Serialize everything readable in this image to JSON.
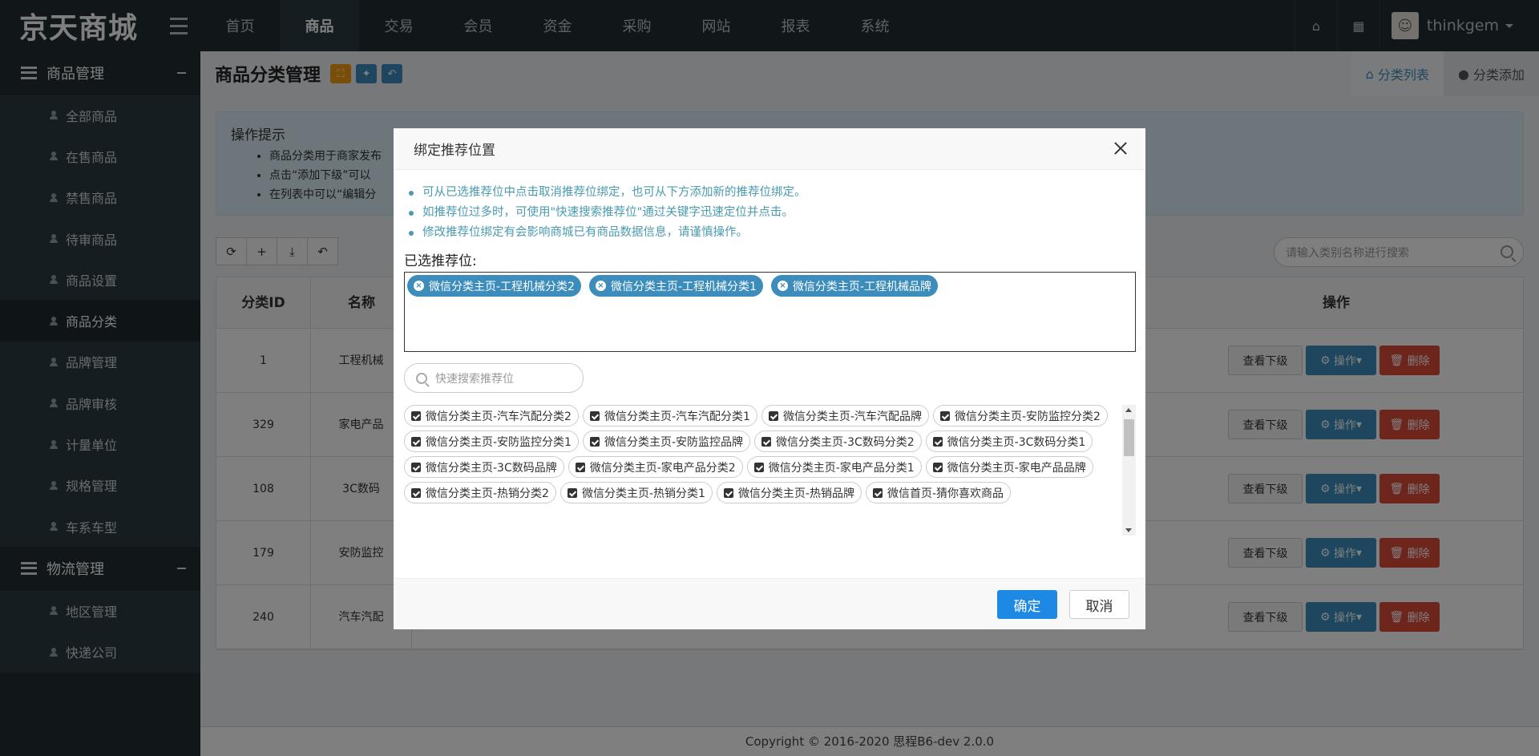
{
  "brand": "京天商城",
  "topnav": [
    "首页",
    "商品",
    "交易",
    "会员",
    "资金",
    "采购",
    "网站",
    "报表",
    "系统"
  ],
  "topright": {
    "home_icon": "home-icon",
    "grid_icon": "grid-icon",
    "username": "thinkgem"
  },
  "sidebar": {
    "group1": "商品管理",
    "items1": [
      "全部商品",
      "在售商品",
      "禁售商品",
      "待审商品",
      "商品设置",
      "商品分类",
      "品牌管理",
      "品牌审核",
      "计量单位",
      "规格管理",
      "车系车型"
    ],
    "group2": "物流管理",
    "items2": [
      "地区管理",
      "快递公司"
    ]
  },
  "header": {
    "title": "商品分类管理",
    "tab_list": "分类列表",
    "tab_add": "分类添加"
  },
  "tips": {
    "title": "操作提示",
    "items": [
      "商品分类用于商家发布",
      "点击“添加下级”可以",
      "在列表中可以“编辑分"
    ]
  },
  "search": {
    "placeholder": "请输入类别名称进行搜索"
  },
  "table": {
    "headers": {
      "id": "分类ID",
      "name": "名称",
      "op": "操作"
    },
    "rows": [
      {
        "id": "1",
        "name": "工程机械"
      },
      {
        "id": "329",
        "name": "家电产品"
      },
      {
        "id": "108",
        "name": "3C数码"
      },
      {
        "id": "179",
        "name": "安防监控"
      },
      {
        "id": "240",
        "name": "汽车汽配"
      }
    ],
    "btn_view": "查看下级",
    "btn_op": "操作",
    "btn_del": "删除"
  },
  "footer": "Copyright © 2016-2020 思程B6-dev 2.0.0",
  "modal": {
    "title": "绑定推荐位置",
    "hints": [
      "可从已选推荐位中点击取消推荐位绑定，也可从下方添加新的推荐位绑定。",
      "如推荐位过多时，可使用\"快速搜索推荐位\"通过关键字迅速定位并点击。",
      "修改推荐位绑定有会影响商城已有商品数据信息，请谨慎操作。"
    ],
    "selected_label": "已选推荐位:",
    "selected": [
      "微信分类主页-工程机械分类2",
      "微信分类主页-工程机械分类1",
      "微信分类主页-工程机械品牌"
    ],
    "quick_search_placeholder": "快速搜索推荐位",
    "options": [
      "微信分类主页-汽车汽配分类2",
      "微信分类主页-汽车汽配分类1",
      "微信分类主页-汽车汽配品牌",
      "微信分类主页-安防监控分类2",
      "微信分类主页-安防监控分类1",
      "微信分类主页-安防监控品牌",
      "微信分类主页-3C数码分类2",
      "微信分类主页-3C数码分类1",
      "微信分类主页-3C数码品牌",
      "微信分类主页-家电产品分类2",
      "微信分类主页-家电产品分类1",
      "微信分类主页-家电产品品牌",
      "微信分类主页-热销分类2",
      "微信分类主页-热销分类1",
      "微信分类主页-热销品牌",
      "微信首页-猜你喜欢商品"
    ],
    "ok": "确定",
    "cancel": "取消"
  }
}
